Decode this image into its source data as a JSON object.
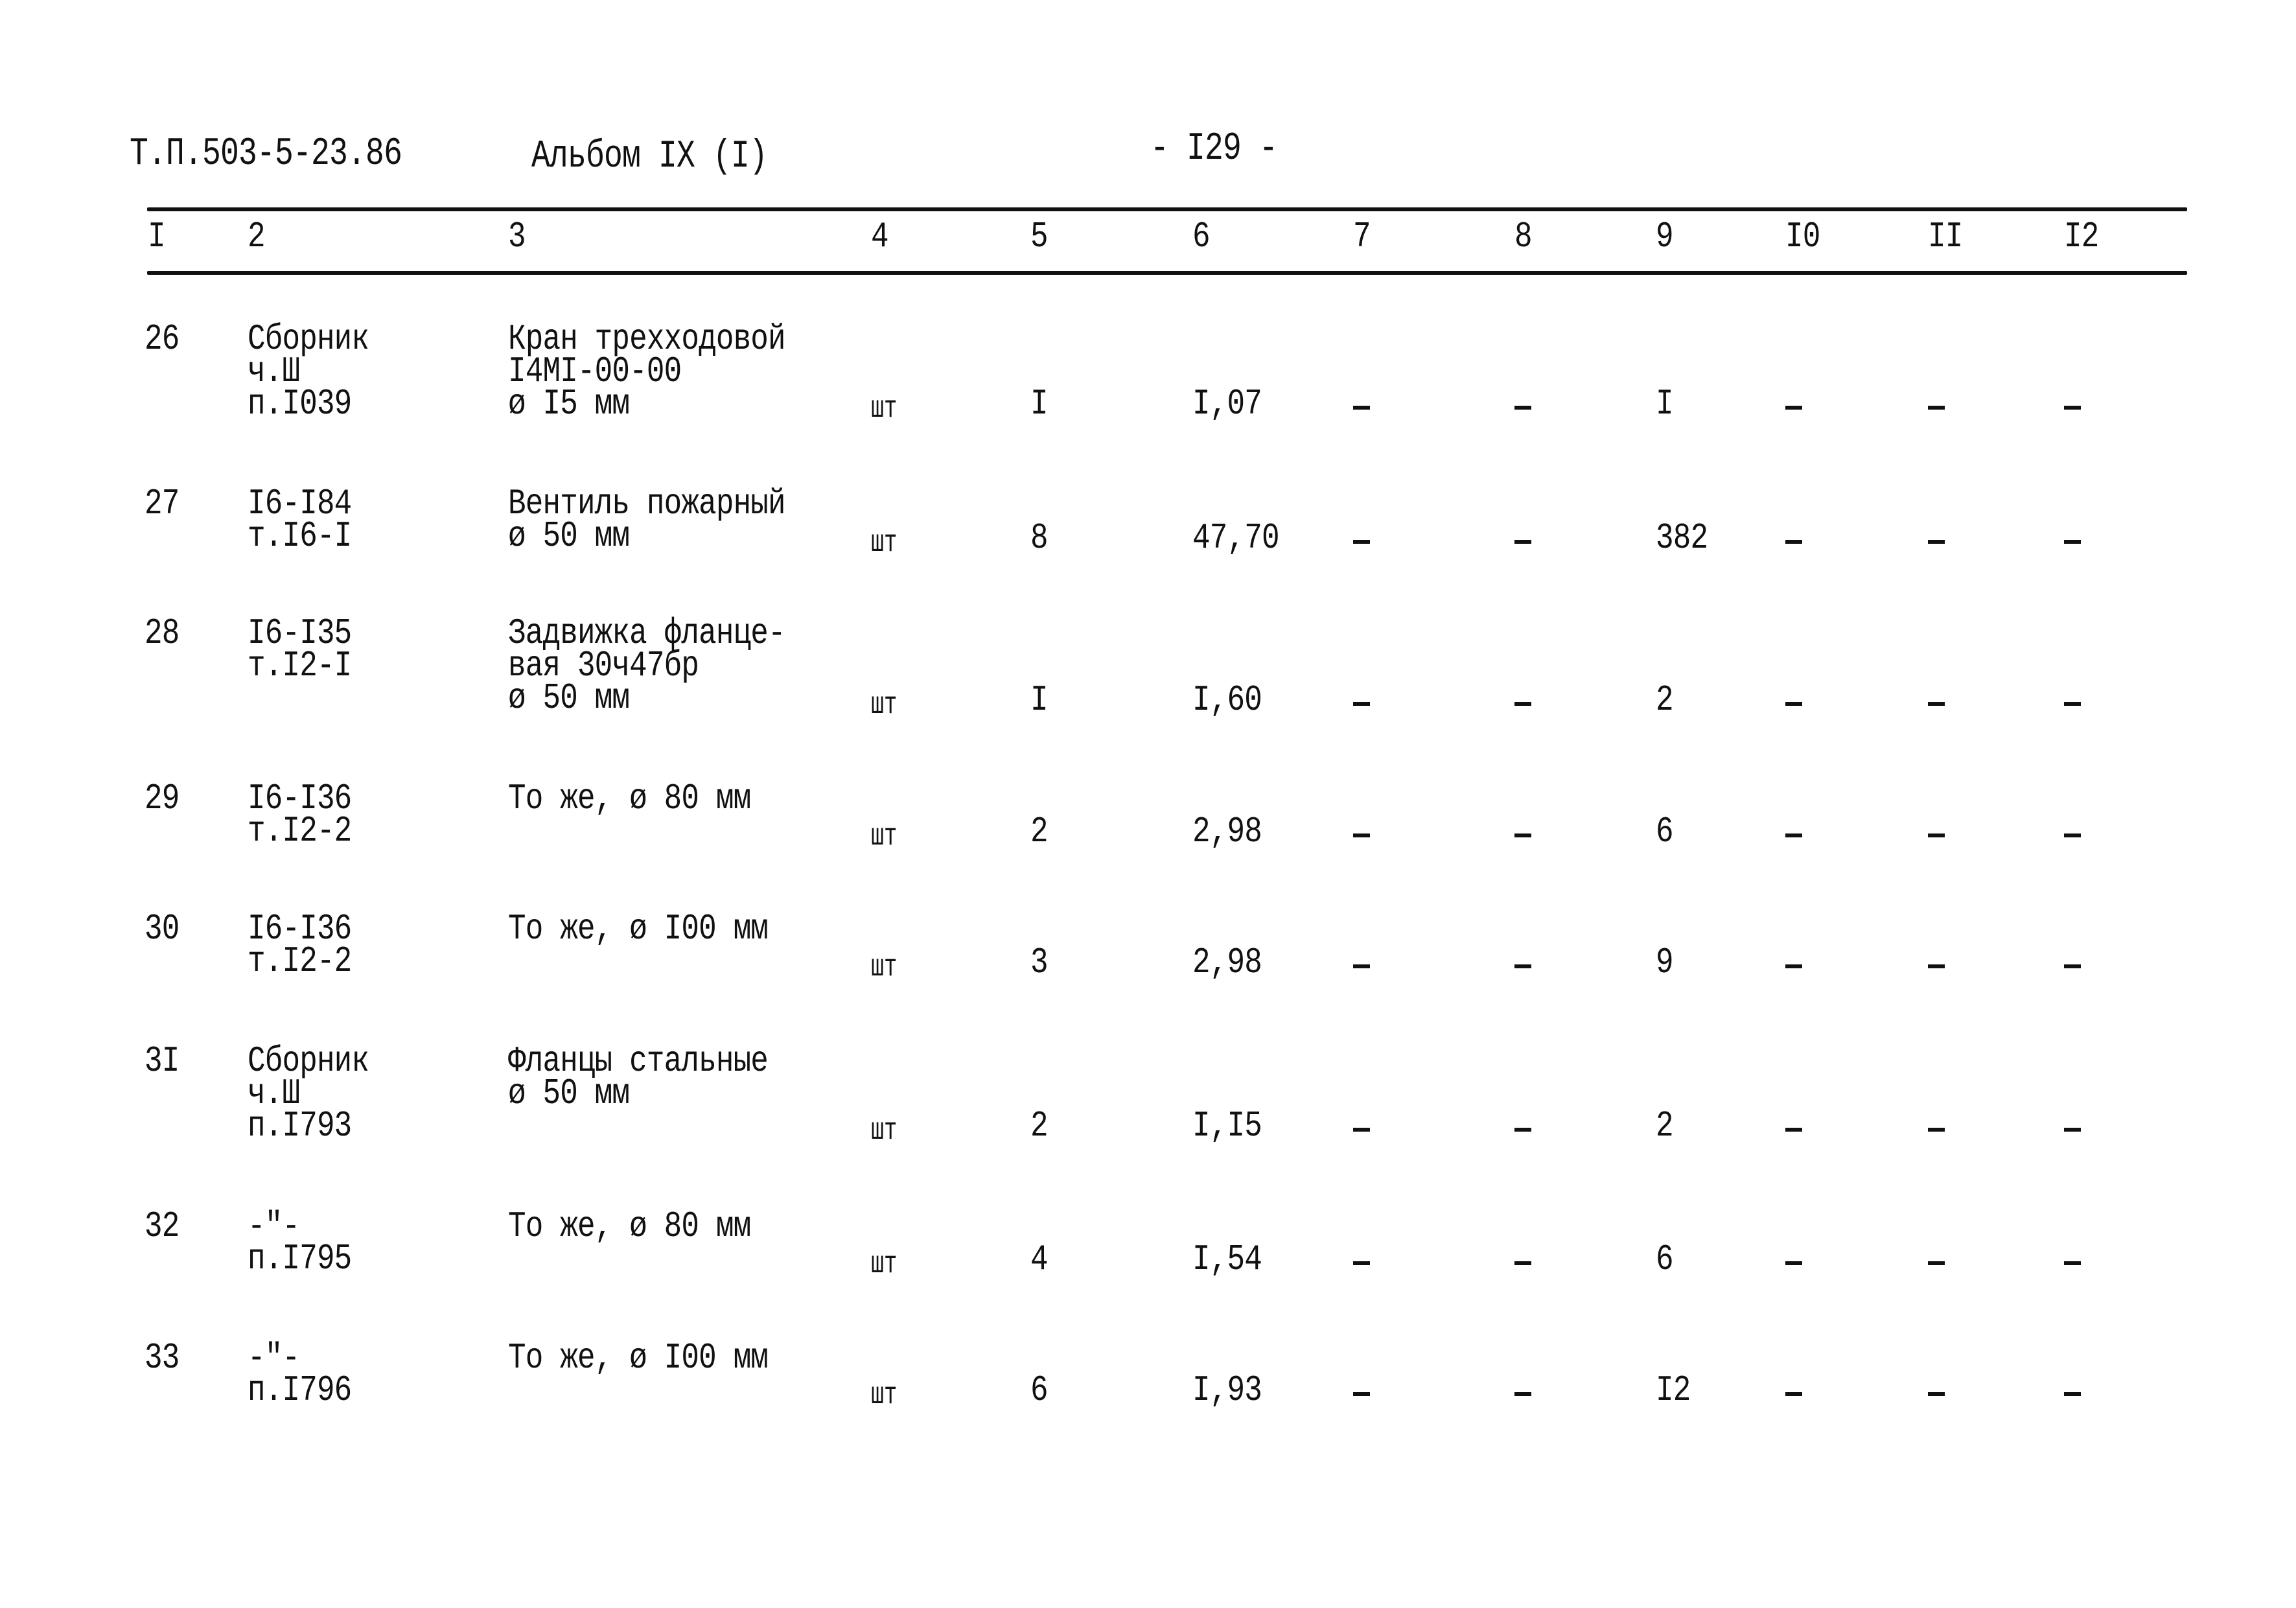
{
  "header": {
    "doc_code": "Т.П.503-5-23.86",
    "album": "Альбом IX (I)",
    "page_number": "- I29 -"
  },
  "table": {
    "column_headers": [
      "I",
      "2",
      "3",
      "4",
      "5",
      "6",
      "7",
      "8",
      "9",
      "I0",
      "II",
      "I2"
    ],
    "rows": [
      {
        "num": "26",
        "ref": [
          "Сборник",
          "ч.Ш",
          "п.I039"
        ],
        "desc": [
          "Кран трехходовой",
          "I4MI-00-00",
          "ø I5 мм"
        ],
        "unit": "шт",
        "qty": "I",
        "c6": "I,07",
        "c7": "-",
        "c8": "-",
        "c9": "I",
        "c10": "-",
        "c11": "-",
        "c12": "-"
      },
      {
        "num": "27",
        "ref": [
          "I6-I84",
          "т.I6-I"
        ],
        "desc": [
          "Вентиль пожарный",
          "ø 50 мм"
        ],
        "unit": "шт",
        "qty": "8",
        "c6": "47,70",
        "c7": "-",
        "c8": "-",
        "c9": "382",
        "c10": "-",
        "c11": "-",
        "c12": "-"
      },
      {
        "num": "28",
        "ref": [
          "I6-I35",
          "т.I2-I"
        ],
        "desc": [
          "Задвижка фланце-",
          "вая 30ч47бр",
          "ø 50 мм"
        ],
        "unit": "шт",
        "qty": "I",
        "c6": "I,60",
        "c7": "-",
        "c8": "-",
        "c9": "2",
        "c10": "-",
        "c11": "-",
        "c12": "-"
      },
      {
        "num": "29",
        "ref": [
          "I6-I36",
          "т.I2-2"
        ],
        "desc": [
          "То же, ø 80 мм"
        ],
        "unit": "шт",
        "qty": "2",
        "c6": "2,98",
        "c7": "-",
        "c8": "-",
        "c9": "6",
        "c10": "-",
        "c11": "-",
        "c12": "-"
      },
      {
        "num": "30",
        "ref": [
          "I6-I36",
          "т.I2-2"
        ],
        "desc": [
          "То же, ø I00 мм"
        ],
        "unit": "шт",
        "qty": "3",
        "c6": "2,98",
        "c7": "-",
        "c8": "-",
        "c9": "9",
        "c10": "-",
        "c11": "-",
        "c12": "-"
      },
      {
        "num": "3I",
        "ref": [
          "Сборник",
          "ч.Ш",
          "п.I793"
        ],
        "desc": [
          "Фланцы стальные",
          "ø 50 мм"
        ],
        "unit": "шт",
        "qty": "2",
        "c6": "I,I5",
        "c7": "-",
        "c8": "-",
        "c9": "2",
        "c10": "-",
        "c11": "-",
        "c12": "-"
      },
      {
        "num": "32",
        "ref": [
          "-\"-",
          "п.I795"
        ],
        "desc": [
          "То же, ø 80 мм"
        ],
        "unit": "шт",
        "qty": "4",
        "c6": "I,54",
        "c7": "-",
        "c8": "-",
        "c9": "6",
        "c10": "-",
        "c11": "-",
        "c12": "-"
      },
      {
        "num": "33",
        "ref": [
          "-\"-",
          "п.I796"
        ],
        "desc": [
          "То же, ø I00 мм"
        ],
        "unit": "шт",
        "qty": "6",
        "c6": "I,93",
        "c7": "-",
        "c8": "-",
        "c9": "I2",
        "c10": "-",
        "c11": "-",
        "c12": "-"
      }
    ]
  }
}
